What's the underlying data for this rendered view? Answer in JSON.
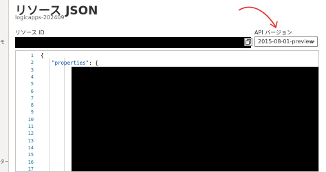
{
  "panel": {
    "title": "リソース JSON",
    "subtitle": "logicapps-202409"
  },
  "resource_id": {
    "label": "リソース ID",
    "value": ""
  },
  "api_version": {
    "label": "API バージョン",
    "selected": "2015-08-01-preview"
  },
  "backdrop": {
    "peek_top": "モ",
    "peek_bottom": "ター"
  },
  "editor": {
    "line_numbers": [
      "1",
      "2",
      "3",
      "4",
      "5",
      "6",
      "7",
      "8",
      "9",
      "10",
      "11",
      "12",
      "13",
      "14",
      "15",
      "16",
      "17"
    ],
    "lines": {
      "line1": "{",
      "line2_key": "\"properties\"",
      "line2_rest": ": {",
      "line16": "},"
    }
  },
  "colors": {
    "annotation_arrow": "#e0302a",
    "line_number": "#237893",
    "json_key": "#0451a5"
  },
  "icons": {
    "copy": "copy-icon",
    "chevron": "chevron-down-icon"
  }
}
